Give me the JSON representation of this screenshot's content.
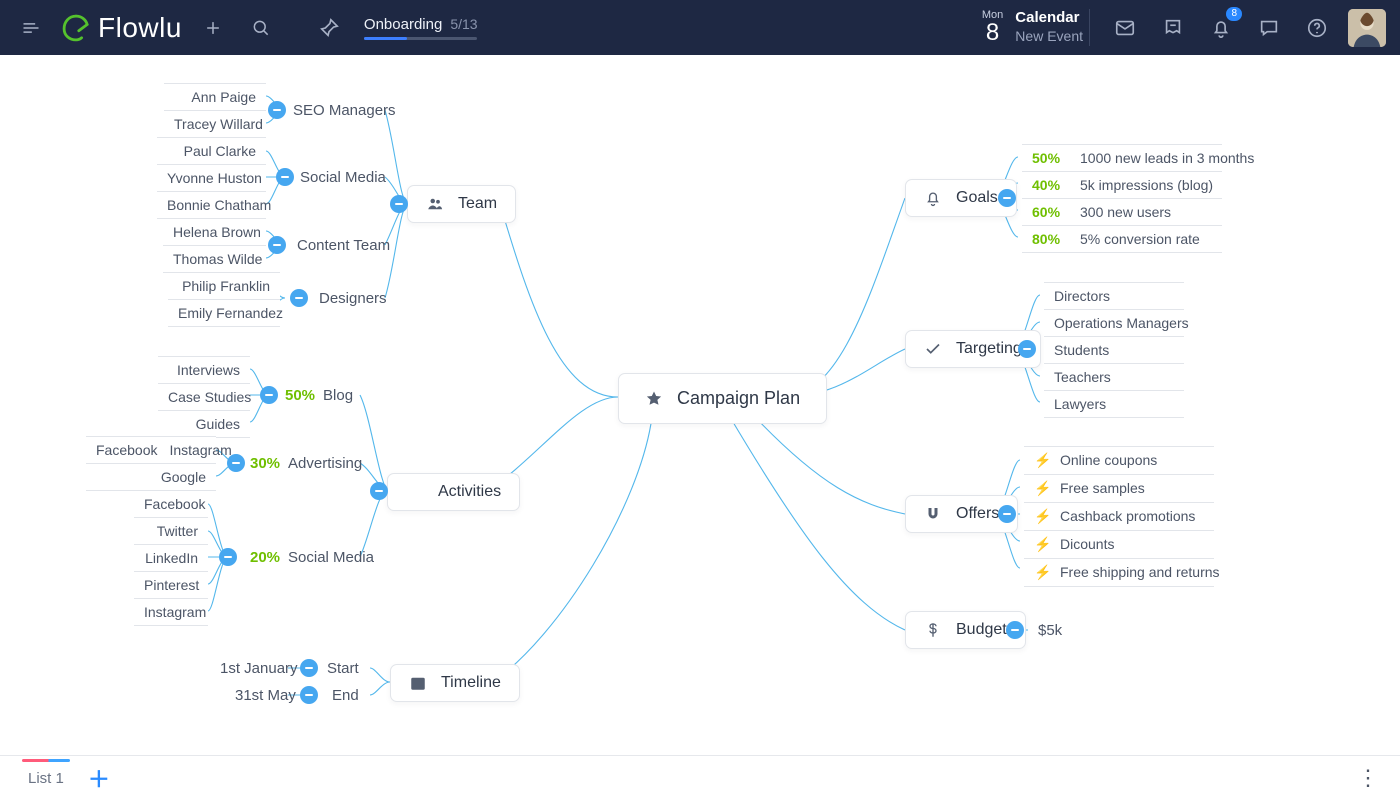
{
  "header": {
    "brand": "Flowlu",
    "onboarding_label": "Onboarding",
    "onboarding_progress": "5/13",
    "calendar_day": "Mon",
    "calendar_date": "8",
    "calendar_title": "Calendar",
    "calendar_subtitle": "New Event",
    "notification_count": "8"
  },
  "mindmap": {
    "center": "Campaign Plan",
    "team": {
      "label": "Team",
      "groups": {
        "seo": {
          "label": "SEO Managers",
          "members": [
            "Ann Paige",
            "Tracey  Willard"
          ]
        },
        "social": {
          "label": "Social Media",
          "members": [
            "Paul Clarke",
            "Yvonne Huston",
            "Bonnie Chatham"
          ]
        },
        "content": {
          "label": "Content Team",
          "members": [
            "Helena Brown",
            "Thomas Wilde"
          ]
        },
        "designers": {
          "label": "Designers",
          "members": [
            "Philip Franklin",
            "Emily Fernandez"
          ]
        }
      }
    },
    "activities": {
      "label": "Activities",
      "blog": {
        "pct": "50%",
        "label": "Blog",
        "items": [
          "Interviews",
          "Case Studies",
          "Guides"
        ]
      },
      "advertising": {
        "pct": "30%",
        "label": "Advertising",
        "items_split": [
          "Facebook",
          "Instagram"
        ],
        "items": [
          "Google"
        ]
      },
      "social": {
        "pct": "20%",
        "label": "Social Media",
        "items": [
          "Facebook",
          "Twitter",
          "LinkedIn",
          "Pinterest",
          "Instagram"
        ]
      }
    },
    "timeline": {
      "label": "Timeline",
      "start": {
        "label": "Start",
        "value": "1st January"
      },
      "end": {
        "label": "End",
        "value": "31st May"
      }
    },
    "goals": {
      "label": "Goals",
      "items": [
        {
          "pct": "50%",
          "text": "1000 new leads in 3 months"
        },
        {
          "pct": "40%",
          "text": "5k impressions (blog)"
        },
        {
          "pct": "60%",
          "text": "300 new users"
        },
        {
          "pct": "80%",
          "text": "5% conversion rate"
        }
      ]
    },
    "targeting": {
      "label": "Targeting",
      "items": [
        "Directors",
        "Operations Managers",
        "Students",
        "Teachers",
        "Lawyers"
      ]
    },
    "offers": {
      "label": "Offers",
      "items": [
        {
          "color": "y",
          "text": "Online coupons"
        },
        {
          "color": "g",
          "text": "Free samples"
        },
        {
          "color": "b",
          "text": "Cashback promotions"
        },
        {
          "color": "y",
          "text": "Dicounts"
        },
        {
          "color": "g",
          "text": "Free shipping and returns"
        }
      ]
    },
    "budget": {
      "label": "Budget",
      "value": "$5k"
    }
  },
  "footer": {
    "active_tab": "List 1"
  }
}
